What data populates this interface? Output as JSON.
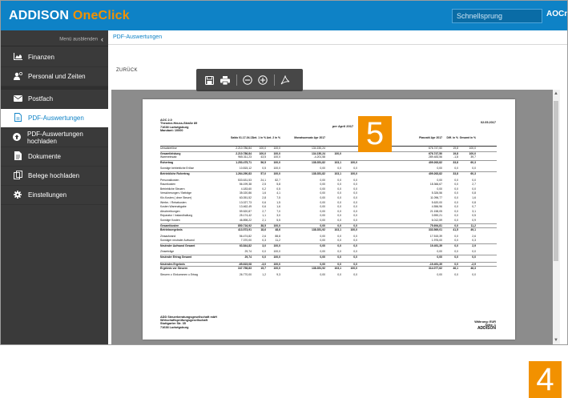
{
  "app": {
    "brand_main": "ADDISON",
    "brand_accent": "OneClick",
    "search_placeholder": "Schnellsprung",
    "user": "AOCnext"
  },
  "colors": {
    "primary": "#0e82c6",
    "accent": "#f29100",
    "sidebar": "#3a3a3a"
  },
  "sidebar": {
    "toggle_label": "Menü ausblenden",
    "items": [
      {
        "label": "Finanzen",
        "icon": "chart-area-icon"
      },
      {
        "label": "Personal und Zeiten",
        "icon": "user-clock-icon"
      },
      {
        "label": "Postfach",
        "icon": "envelope-icon"
      },
      {
        "label": "PDF-Auswertungen",
        "icon": "file-pdf-icon",
        "active": true
      },
      {
        "label": "PDF-Auswertungen hochladen",
        "icon": "upload-circle-icon"
      },
      {
        "label": "Dokumente",
        "icon": "document-icon"
      },
      {
        "label": "Belege hochladen",
        "icon": "documents-icon"
      },
      {
        "label": "Einstellungen",
        "icon": "gear-icon"
      }
    ]
  },
  "content": {
    "breadcrumb": "PDF-Auswertungen",
    "back_label": "ZURÜCK"
  },
  "toolbar": {
    "icons": [
      "save-icon",
      "print-icon",
      "zoom-out-icon",
      "zoom-in-icon",
      "acrobat-icon"
    ]
  },
  "pdf": {
    "company": "AOC 2.0",
    "street": "Theodor-Heuss-Straße 89",
    "city": "71638 Ludwigsburg",
    "client": "Mandant: 10000",
    "date": "02.05.2017",
    "period": "per April 2017",
    "headers": {
      "c1": "Saldo 01.17-04.17",
      "c2": "Ant. 1 in %",
      "c3": "Ant. 2 in %",
      "c4": "Monatsumsatz Apr 2017",
      "c5": "",
      "c6": "",
      "c7": "Planzahl Apr 2017",
      "c8": "Diff. in %",
      "c9": "Gesamt in %"
    },
    "rows": [
      {
        "label": "Umsatzerlöse",
        "v": [
          "2.210.786,84",
          "100,0",
          "100,0",
          "134.150,24",
          "",
          "",
          "676.747,50",
          "19,8",
          "100,0"
        ]
      },
      {
        "label": "Gesamtleistung",
        "bold": true,
        "v": [
          "2.210.786,84",
          "100,0",
          "100,0",
          "134.150,24",
          "100,0",
          "",
          "676.747,50",
          "19,8",
          "100,0"
        ]
      },
      {
        "label": "Wareneinsatz",
        "v": [
          "965.311,23",
          "43,5",
          "100,0",
          "-4.201,58",
          "",
          "",
          "289.483,56",
          "-1,8",
          "39,7"
        ]
      },
      {
        "label": "Rohertrag",
        "bold": true,
        "v": [
          "1.253.475,71",
          "56,5",
          "100,0",
          "138.351,82",
          "103,1",
          "100,0",
          "409.263,82",
          "33,8",
          "60,3"
        ]
      },
      {
        "gap": true
      },
      {
        "label": "Sonstige betriebliche Erlöse",
        "v": [
          "10.815,12",
          "0,5",
          "100,0",
          "0,00",
          "0,0",
          "0,0",
          "0,00",
          "0,0",
          "0,0"
        ]
      },
      {
        "label": "Betriebliche Rohertrag",
        "bold": true,
        "v": [
          "1.264.290,83",
          "57,0",
          "100,0",
          "138.351,82",
          "103,1",
          "100,0",
          "409.263,82",
          "33,8",
          "60,3"
        ]
      },
      {
        "gap": true
      },
      {
        "label": "Personalkosten",
        "v": [
          "533.631,53",
          "24,1",
          "82,7",
          "0,00",
          "0,0",
          "0,0",
          "0,00",
          "0,0",
          "0,0"
        ]
      },
      {
        "label": "Raumkosten",
        "v": [
          "56.199,38",
          "2,5",
          "5,8",
          "0,00",
          "0,0",
          "0,0",
          "18.366,67",
          "0,0",
          "2,7"
        ]
      },
      {
        "label": "Betriebliche Steuern",
        "v": [
          "4.183,60",
          "0,2",
          "0,5",
          "0,00",
          "0,0",
          "0,0",
          "0,00",
          "0,0",
          "0,0"
        ]
      },
      {
        "label": "Versicherungen / Beiträge",
        "v": [
          "35.020,86",
          "1,6",
          "4,1",
          "0,00",
          "0,0",
          "0,0",
          "5.326,56",
          "0,0",
          "0,8"
        ]
      },
      {
        "label": "Kfz-Kosten ( ohne Steuer)",
        "v": [
          "63.051,52",
          "2,8",
          "7,5",
          "0,00",
          "0,0",
          "0,0",
          "11.096,77",
          "0,0",
          "1,6"
        ]
      },
      {
        "label": "Werbe- / Reisekosten",
        "v": [
          "13.027,73",
          "0,6",
          "1,5",
          "0,00",
          "0,0",
          "0,0",
          "5.620,00",
          "0,0",
          "0,8"
        ]
      },
      {
        "label": "Kosten Warenabgabe",
        "v": [
          "13.462,49",
          "0,6",
          "1,6",
          "0,00",
          "0,0",
          "0,0",
          "4.556,96",
          "0,0",
          "0,7"
        ]
      },
      {
        "label": "Abschreibungen",
        "v": [
          "59.520,87",
          "2,7",
          "7,0",
          "0,00",
          "0,0",
          "0,0",
          "21.158,05",
          "0,0",
          "3,1"
        ]
      },
      {
        "label": "Reparatur / Instandhaltung",
        "v": [
          "25.174,42",
          "1,1",
          "3,0",
          "0,00",
          "0,0",
          "0,0",
          "3.590,21",
          "0,0",
          "0,5"
        ]
      },
      {
        "label": "Sonstige Kosten",
        "v": [
          "46.898,22",
          "2,1",
          "5,5",
          "0,00",
          "0,0",
          "0,0",
          "6.012,59",
          "0,0",
          "0,9"
        ]
      },
      {
        "label": "Gesamtkosten",
        "bold": true,
        "v": [
          "850.716,92",
          "38,5",
          "100,0",
          "0,00",
          "0,0",
          "0,0",
          "75.694,81",
          "0,0",
          "11,2"
        ]
      },
      {
        "label": "Betriebsergebnis",
        "bold": true,
        "v": [
          "413.573,91",
          "18,6",
          "48,6",
          "138.351,92",
          "103,1",
          "100,0",
          "333.569,01",
          "41,5",
          "49,1"
        ]
      },
      {
        "gap": true
      },
      {
        "label": "Zinsaufwand",
        "v": [
          "56.474,82",
          "2,6",
          "88,8",
          "0,00",
          "0,0",
          "0,0",
          "17.515,39",
          "0,0",
          "2,6"
        ]
      },
      {
        "label": "Sonstiger neutraler Aufwand",
        "v": [
          "7.370,00",
          "0,3",
          "11,2",
          "0,00",
          "0,0",
          "0,0",
          "1.976,00",
          "0,0",
          "0,3"
        ]
      },
      {
        "label": "Neutraler Aufwand Gesamt",
        "bold": true,
        "v": [
          "63.844,82",
          "3,0",
          "100,0",
          "0,00",
          "0,0",
          "0,0",
          "19.491,39",
          "0,0",
          "2,9"
        ]
      },
      {
        "gap": true
      },
      {
        "label": "Zinserträge",
        "v": [
          "29,74",
          "0,0",
          "100,0",
          "0,00",
          "0,0",
          "0,0",
          "0,00",
          "0,0",
          "0,0"
        ]
      },
      {
        "label": "Neutraler Ertrag Gesamt",
        "bold": true,
        "v": [
          "29,74",
          "0,0",
          "100,0",
          "0,00",
          "0,0",
          "0,0",
          "0,00",
          "0,0",
          "0,0"
        ]
      },
      {
        "gap": true
      },
      {
        "label": "Neutrales Ergebnis",
        "bold": true,
        "v": [
          "-65.815,08",
          "-3,0",
          "100,0",
          "0,00",
          "0,0",
          "0,0",
          "-19.491,39",
          "0,0",
          "-2,9"
        ]
      },
      {
        "label": "Ergebnis vor Steuern",
        "bold": true,
        "v": [
          "347.758,83",
          "15,7",
          "100,0",
          "138.351,92",
          "103,1",
          "100,0",
          "314.077,62",
          "46,1",
          "46,3"
        ]
      },
      {
        "gap": true
      },
      {
        "label": "Steuern v. Einkommen u Ertrag",
        "v": [
          "26.770,00",
          "1,2",
          "9,3",
          "0,00",
          "0,0",
          "0,0",
          "0,00",
          "0,0",
          "0,0"
        ]
      }
    ],
    "footer_lines": [
      "ADD Steuerberatungsgesellschaft mbH",
      "Wirtschaftsprüfungsgesellschaft",
      "Stuttgarter Str. 35",
      "71638 Ludwigsburg"
    ],
    "currency": "Währung: EUR",
    "page": "Seite: 1",
    "footer_logo": "ADDISON"
  },
  "badges": {
    "five": "5",
    "four": "4"
  }
}
